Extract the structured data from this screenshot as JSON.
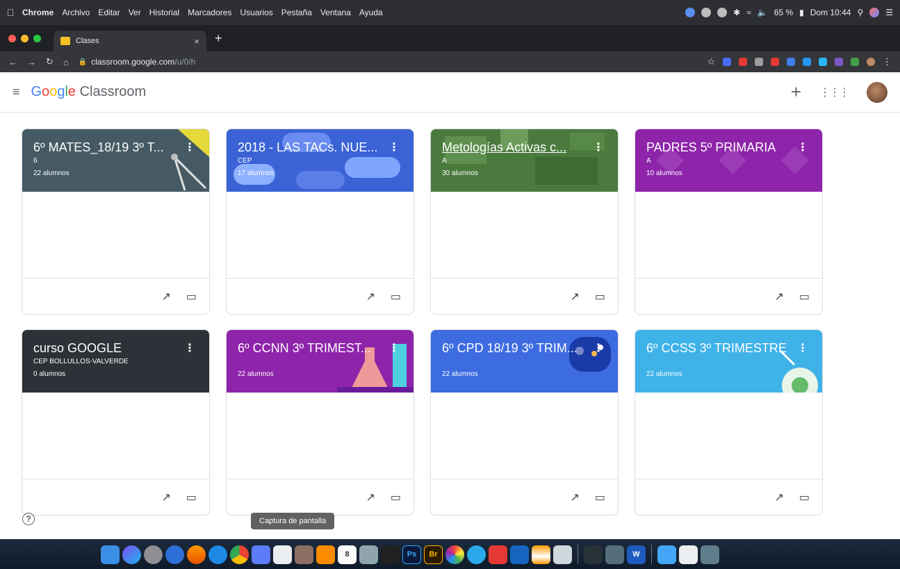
{
  "menubar": {
    "app": "Chrome",
    "menus": [
      "Archivo",
      "Editar",
      "Ver",
      "Historial",
      "Marcadores",
      "Usuarios",
      "Pestaña",
      "Ventana",
      "Ayuda"
    ],
    "battery": "65 %",
    "clock": "Dom 10:44"
  },
  "browser": {
    "tab_title": "Clases",
    "tab_close": "×",
    "new_tab": "+",
    "url_host": "classroom.google.com",
    "url_path": "/u/0/h"
  },
  "header": {
    "logo_google": [
      "G",
      "o",
      "o",
      "g",
      "l",
      "e"
    ],
    "logo_product": "Classroom",
    "plus": "+"
  },
  "cards": [
    {
      "title": "6º MATES_18/19 3º T...",
      "subtitle": "6",
      "count": "22 alumnos",
      "color": "#455a64"
    },
    {
      "title": "2018 - LAS TACs. NUE...",
      "subtitle": "CEP",
      "count": "17 alumnos",
      "color": "#3b63d6"
    },
    {
      "title": "Metologías Activas c...",
      "subtitle": "A",
      "count": "30 alumnos",
      "color": "#4a7a3e"
    },
    {
      "title": "PADRES 5º PRIMARIA",
      "subtitle": "A",
      "count": "10 alumnos",
      "color": "#8e24aa"
    },
    {
      "title": "curso GOOGLE",
      "subtitle": "CEP BOLLULLOS-VALVERDE",
      "count": "0 alumnos",
      "color": "#2d3238"
    },
    {
      "title": "6º CCNN 3º TRIMEST...",
      "subtitle": "",
      "count": "22 alumnos",
      "color": "#8e24aa"
    },
    {
      "title": "6º CPD 18/19 3º TRIM...",
      "subtitle": "",
      "count": "22 alumnos",
      "color": "#3d6be0"
    },
    {
      "title": "6º CCSS 3º TRIMESTRE",
      "subtitle": "",
      "count": "22 alumnos",
      "color": "#3fb2e8"
    }
  ],
  "help": "?",
  "tooltip": "Captura de pantalla",
  "dock": {
    "ps_label": "Ps",
    "br_label": "Br",
    "cal_label": "8",
    "word_label": "W"
  }
}
